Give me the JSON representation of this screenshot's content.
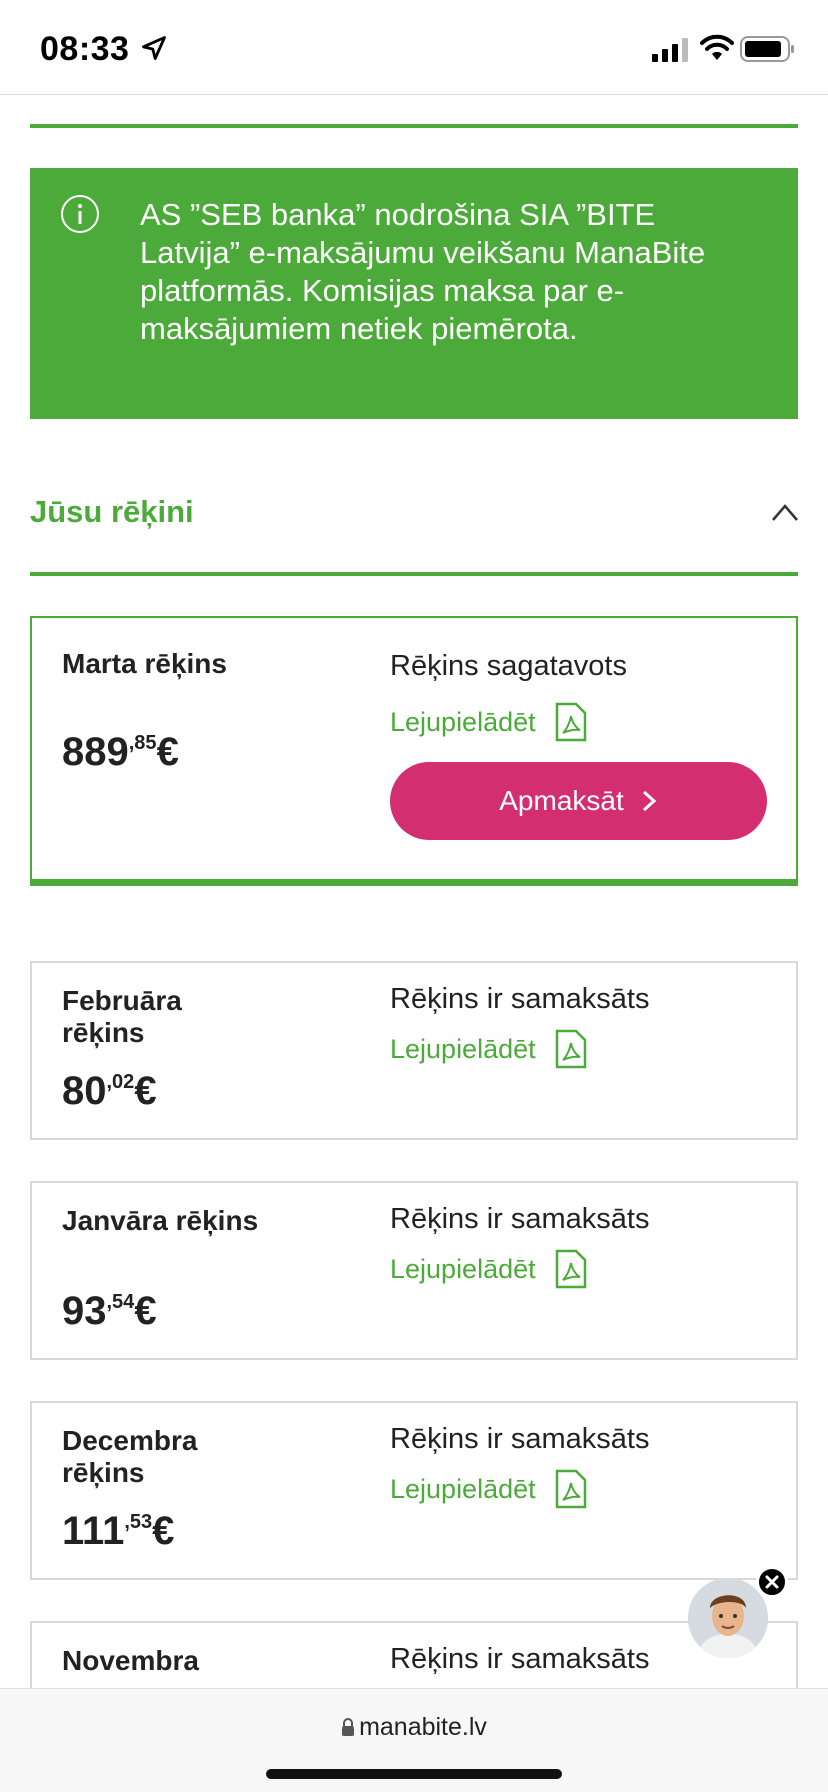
{
  "status_bar": {
    "time": "08:33"
  },
  "banner": {
    "text": "AS ”SEB banka” nodrošina SIA ”BITE Latvija” e-maksājumu veikšanu ManaBite platformās. Komisijas maksa par e-maksājumiem netiek piemērota."
  },
  "section": {
    "title": "Jūsu rēķini"
  },
  "bills": [
    {
      "month": "Marta rēķins",
      "amount_int": "889",
      "amount_dec": ",85",
      "currency": "€",
      "status": "Rēķins sagatavots",
      "download": "Lejupielādēt",
      "pay": "Apmaksāt"
    },
    {
      "month": "Februāra rēķins",
      "amount_int": "80",
      "amount_dec": ",02",
      "currency": "€",
      "status": "Rēķins ir samaksāts",
      "download": "Lejupielādēt"
    },
    {
      "month": "Janvāra rēķins",
      "amount_int": "93",
      "amount_dec": ",54",
      "currency": "€",
      "status": "Rēķins ir samaksāts",
      "download": "Lejupielādēt"
    },
    {
      "month": "Decembra rēķins",
      "amount_int": "111",
      "amount_dec": ",53",
      "currency": "€",
      "status": "Rēķins ir samaksāts",
      "download": "Lejupielādēt"
    },
    {
      "month": "Novembra",
      "status": "Rēķins ir samaksāts"
    }
  ],
  "browser": {
    "url": "manabite.lv"
  },
  "colors": {
    "green": "#4caa3a",
    "pay_button": "#d42e72"
  }
}
